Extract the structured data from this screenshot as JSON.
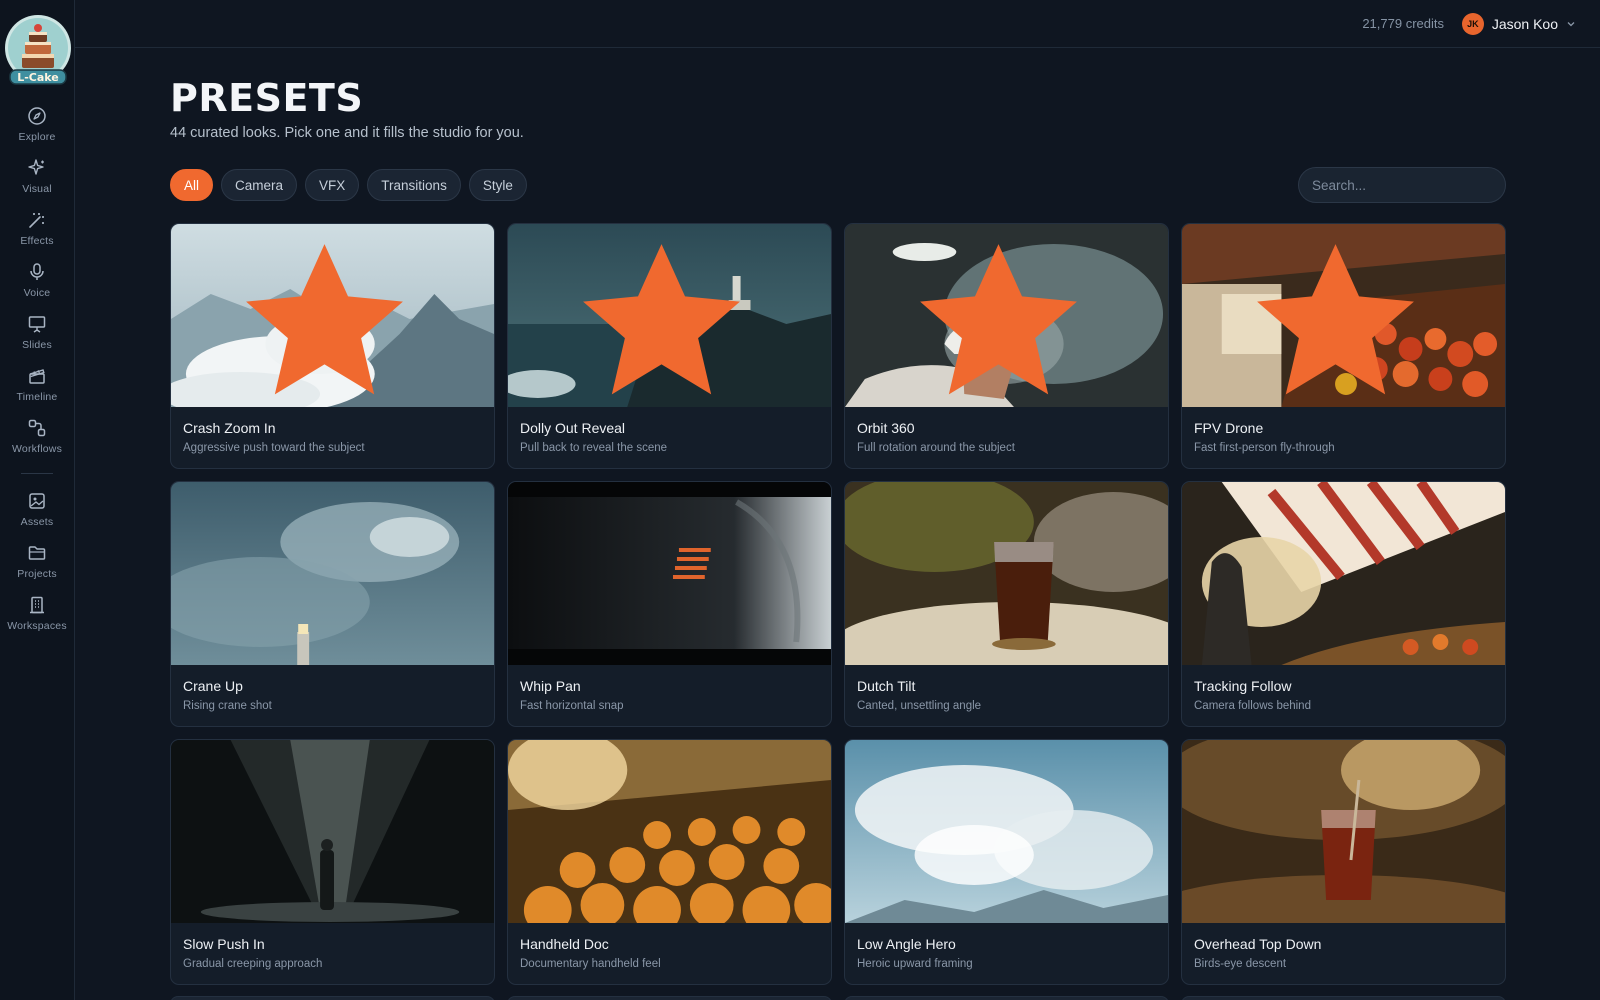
{
  "app": {
    "logo_text": "L-Cake"
  },
  "sidebar": {
    "items": [
      {
        "label": "Explore",
        "icon": "compass-icon"
      },
      {
        "label": "Visual",
        "icon": "sparkle-icon"
      },
      {
        "label": "Effects",
        "icon": "magic-wand-icon"
      },
      {
        "label": "Voice",
        "icon": "microphone-icon"
      },
      {
        "label": "Slides",
        "icon": "presentation-icon"
      },
      {
        "label": "Timeline",
        "icon": "clapperboard-icon"
      },
      {
        "label": "Workflows",
        "icon": "workflow-icon"
      },
      {
        "label": "Assets",
        "icon": "image-gallery-icon"
      },
      {
        "label": "Projects",
        "icon": "folder-icon"
      },
      {
        "label": "Workspaces",
        "icon": "building-icon"
      }
    ]
  },
  "topbar": {
    "credits": "21,779 credits",
    "user": {
      "initials": "JK",
      "name": "Jason Koo"
    }
  },
  "header": {
    "title": "PRESETS",
    "subtitle": "44 curated looks. Pick one and it fills the studio for you."
  },
  "filters": {
    "chips": [
      "All",
      "Camera",
      "VFX",
      "Transitions",
      "Style"
    ],
    "active": "All"
  },
  "search": {
    "placeholder": "Search...",
    "value": ""
  },
  "colors": {
    "accent": "#f0692f",
    "background": "#0f1621",
    "card": "#141d29"
  },
  "presets": [
    {
      "title": "Crash Zoom In",
      "desc": "Aggressive push toward the subject",
      "starred": true
    },
    {
      "title": "Dolly Out Reveal",
      "desc": "Pull back to reveal the scene",
      "starred": true
    },
    {
      "title": "Orbit 360",
      "desc": "Full rotation around the subject",
      "starred": true
    },
    {
      "title": "FPV Drone",
      "desc": "Fast first-person fly-through",
      "starred": true
    },
    {
      "title": "Crane Up",
      "desc": "Rising crane shot",
      "starred": false
    },
    {
      "title": "Whip Pan",
      "desc": "Fast horizontal snap",
      "starred": false
    },
    {
      "title": "Dutch Tilt",
      "desc": "Canted, unsettling angle",
      "starred": false
    },
    {
      "title": "Tracking Follow",
      "desc": "Camera follows behind",
      "starred": false
    },
    {
      "title": "Slow Push In",
      "desc": "Gradual creeping approach",
      "starred": false
    },
    {
      "title": "Handheld Doc",
      "desc": "Documentary handheld feel",
      "starred": false
    },
    {
      "title": "Low Angle Hero",
      "desc": "Heroic upward framing",
      "starred": false
    },
    {
      "title": "Overhead Top Down",
      "desc": "Birds-eye descent",
      "starred": false
    }
  ]
}
